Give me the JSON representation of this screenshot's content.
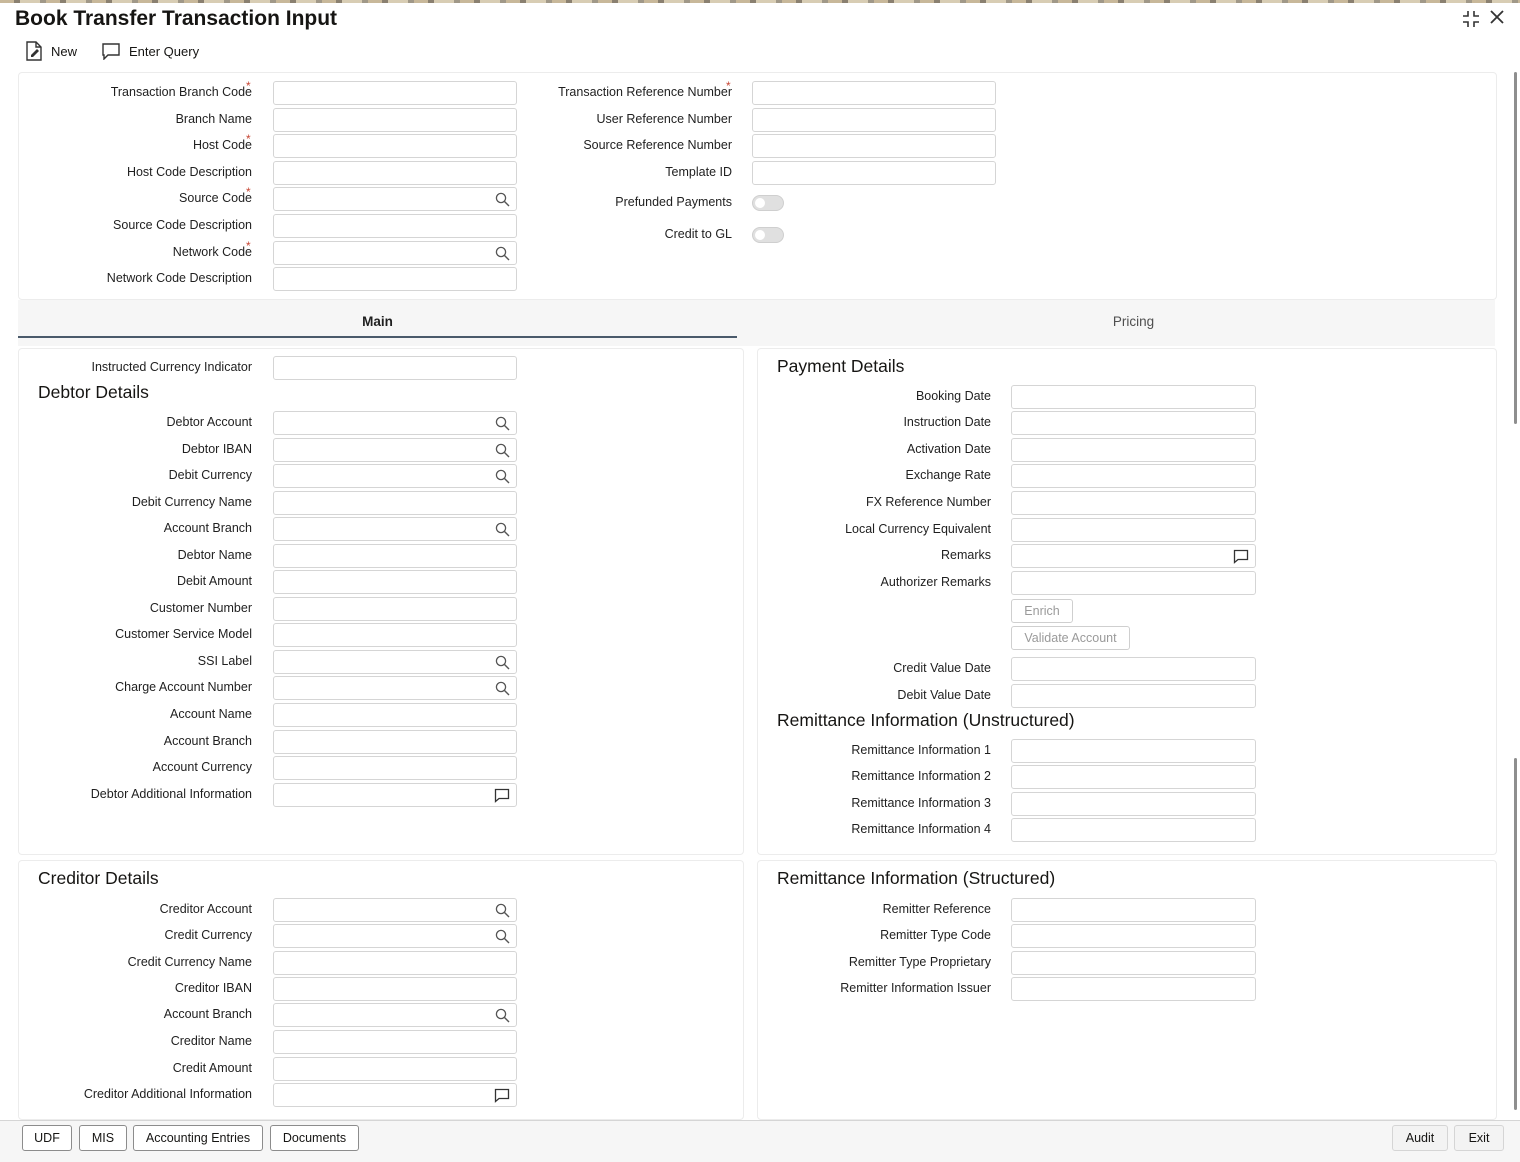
{
  "window": {
    "title": "Book Transfer Transaction Input"
  },
  "toolbar": {
    "new_label": "New",
    "enter_query_label": "Enter Query"
  },
  "header": {
    "left": [
      {
        "label": "Transaction Branch Code",
        "required": "*"
      },
      {
        "label": "Branch Name"
      },
      {
        "label": "Host Code",
        "required": "*"
      },
      {
        "label": "Host Code Description"
      },
      {
        "label": "Source Code",
        "required": "*"
      },
      {
        "label": "Source Code Description"
      },
      {
        "label": "Network Code",
        "required": "*"
      },
      {
        "label": "Network Code Description"
      }
    ],
    "right": [
      {
        "label": "Transaction Reference Number",
        "required": "*"
      },
      {
        "label": "User Reference Number"
      },
      {
        "label": "Source Reference Number"
      },
      {
        "label": "Template ID"
      },
      {
        "label": "Prefunded Payments"
      },
      {
        "label": "Credit to GL"
      }
    ]
  },
  "tabs": [
    {
      "label": "Main"
    },
    {
      "label": "Pricing"
    }
  ],
  "main": {
    "instructed_currency_indicator": "Instructed Currency Indicator",
    "debtor": {
      "title": "Debtor Details",
      "fields": [
        "Debtor Account",
        "Debtor IBAN",
        "Debit Currency",
        "Debit Currency Name",
        "Account Branch",
        "Debtor Name",
        "Debit Amount",
        "Customer Number",
        "Customer Service Model",
        "SSI Label",
        "Charge Account Number",
        "Account Name",
        "Account Branch",
        "Account Currency",
        "Debtor Additional Information"
      ]
    },
    "payment": {
      "title": "Payment Details",
      "fields": [
        "Booking Date",
        "Instruction Date",
        "Activation Date",
        "Exchange Rate",
        "FX Reference Number",
        "Local Currency Equivalent",
        "Remarks",
        "Authorizer Remarks"
      ],
      "enrich_label": "Enrich",
      "validate_label": "Validate Account",
      "value_dates": [
        "Credit Value Date",
        "Debit Value Date"
      ]
    },
    "remit_unstructured": {
      "title": "Remittance Information (Unstructured)",
      "fields": [
        "Remittance Information 1",
        "Remittance Information 2",
        "Remittance Information 3",
        "Remittance Information 4"
      ]
    },
    "creditor": {
      "title": "Creditor Details",
      "fields": [
        "Creditor Account",
        "Credit Currency",
        "Credit Currency Name",
        "Creditor IBAN",
        "Account Branch",
        "Creditor Name",
        "Credit Amount",
        "Creditor Additional Information"
      ]
    },
    "remit_structured": {
      "title": "Remittance Information (Structured)",
      "fields": [
        "Remitter Reference",
        "Remitter Type Code",
        "Remitter Type Proprietary",
        "Remitter Information Issuer"
      ]
    }
  },
  "footer": {
    "udf": "UDF",
    "mis": "MIS",
    "accounting": "Accounting Entries",
    "documents": "Documents",
    "audit": "Audit",
    "exit": "Exit"
  }
}
